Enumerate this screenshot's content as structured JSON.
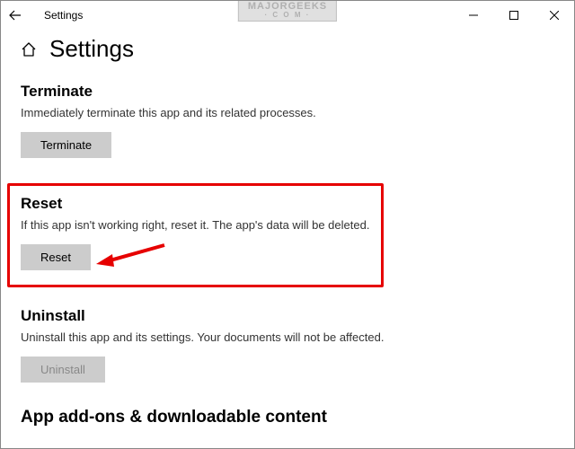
{
  "titlebar": {
    "title": "Settings"
  },
  "watermark": {
    "line1": "MAJORGEEKS",
    "line2": "· C O M ·"
  },
  "page": {
    "title": "Settings"
  },
  "terminate": {
    "heading": "Terminate",
    "description": "Immediately terminate this app and its related processes.",
    "button": "Terminate"
  },
  "reset": {
    "heading": "Reset",
    "description": "If this app isn't working right, reset it. The app's data will be deleted.",
    "button": "Reset"
  },
  "uninstall": {
    "heading": "Uninstall",
    "description": "Uninstall this app and its settings. Your documents will not be affected.",
    "button": "Uninstall"
  },
  "addons": {
    "heading": "App add-ons & downloadable content"
  }
}
